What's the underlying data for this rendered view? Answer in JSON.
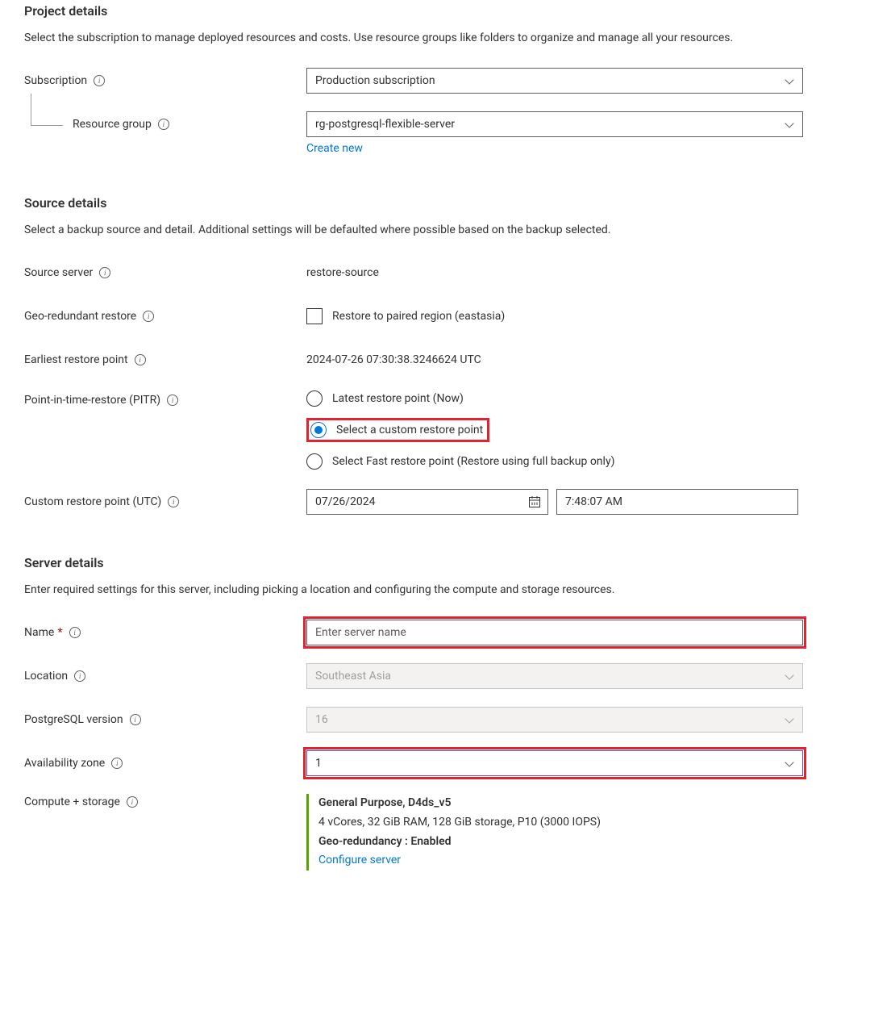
{
  "project": {
    "heading": "Project details",
    "desc": "Select the subscription to manage deployed resources and costs. Use resource groups like folders to organize and manage all your resources.",
    "subscription_label": "Subscription",
    "subscription_value": "Production subscription",
    "rg_label": "Resource group",
    "rg_value": "rg-postgresql-flexible-server",
    "create_new": "Create new"
  },
  "source": {
    "heading": "Source details",
    "desc": "Select a backup source and detail. Additional settings will be defaulted where possible based on the backup selected.",
    "source_server_label": "Source server",
    "source_server_value": "restore-source",
    "geo_label": "Geo-redundant restore",
    "geo_checkbox_label": "Restore to paired region (eastasia)",
    "earliest_label": "Earliest restore point",
    "earliest_value": "2024-07-26 07:30:38.3246624 UTC",
    "pitr_label": "Point-in-time-restore (PITR)",
    "pitr_options": {
      "latest": "Latest restore point (Now)",
      "custom": "Select a custom restore point",
      "fast": "Select Fast restore point (Restore using full backup only)"
    },
    "custom_label": "Custom restore point (UTC)",
    "custom_date": "07/26/2024",
    "custom_time": "7:48:07 AM"
  },
  "server": {
    "heading": "Server details",
    "desc": "Enter required settings for this server, including picking a location and configuring the compute and storage resources.",
    "name_label": "Name",
    "name_placeholder": "Enter server name",
    "location_label": "Location",
    "location_value": "Southeast Asia",
    "pg_label": "PostgreSQL version",
    "pg_value": "16",
    "az_label": "Availability zone",
    "az_value": "1",
    "compute_label": "Compute + storage",
    "compute_title": "General Purpose, D4ds_v5",
    "compute_spec": "4 vCores, 32 GiB RAM, 128 GiB storage, P10 (3000 IOPS)",
    "compute_geo": "Geo-redundancy : Enabled",
    "configure_link": "Configure server"
  }
}
